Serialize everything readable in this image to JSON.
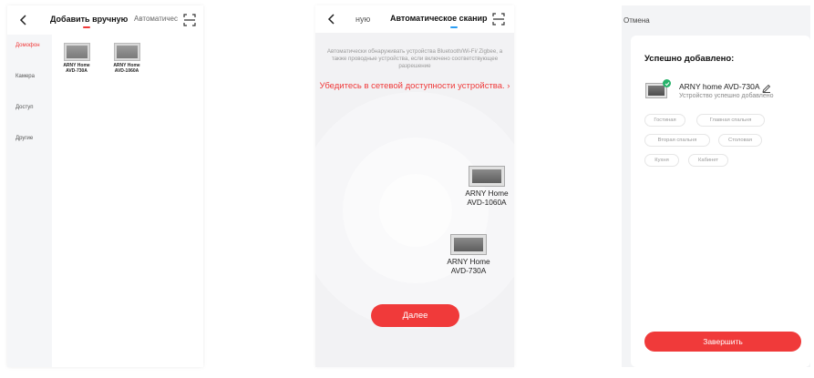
{
  "screen1": {
    "tab_manual": "Добавить вручную",
    "tab_auto": "Автоматическое",
    "sidebar": [
      {
        "label": "Домофон",
        "active": true
      },
      {
        "label": "Камера",
        "active": false
      },
      {
        "label": "Доступ",
        "active": false
      },
      {
        "label": "Другие",
        "active": false
      }
    ],
    "devices": [
      {
        "line1": "ARNY Home",
        "line2": "AVD-730A"
      },
      {
        "line1": "ARNY Home",
        "line2": "AVD-1060A"
      }
    ]
  },
  "screen2": {
    "tab_manual": "ную",
    "tab_auto": "Автоматическое сканир",
    "description": "Автоматически обнаруживать устройства Bluetooth/Wi-Fi/ Zigbee, а также проводные устройства, если включено соответствующее разрешение",
    "network_link": "Убедитесь в сетевой доступности устройства. ›",
    "found_devices": [
      {
        "line1": "ARNY Home",
        "line2": "AVD-1060A"
      },
      {
        "line1": "ARNY Home",
        "line2": "AVD-730A"
      }
    ],
    "next_button": "Далее"
  },
  "screen3": {
    "cancel": "Отмена",
    "title": "Успешно добавлено:",
    "device_name": "ARNY home AVD-730A",
    "status": "Устройство успешно добавлено",
    "rooms": [
      "Гостиная",
      "Главная спальня",
      "Вторая спальня",
      "Столовая",
      "Кухня",
      "Кабинет"
    ],
    "finish_button": "Завершить"
  },
  "colors": {
    "accent": "#f03a3a",
    "blue_indicator": "#2a9df4",
    "success": "#27b36a"
  }
}
